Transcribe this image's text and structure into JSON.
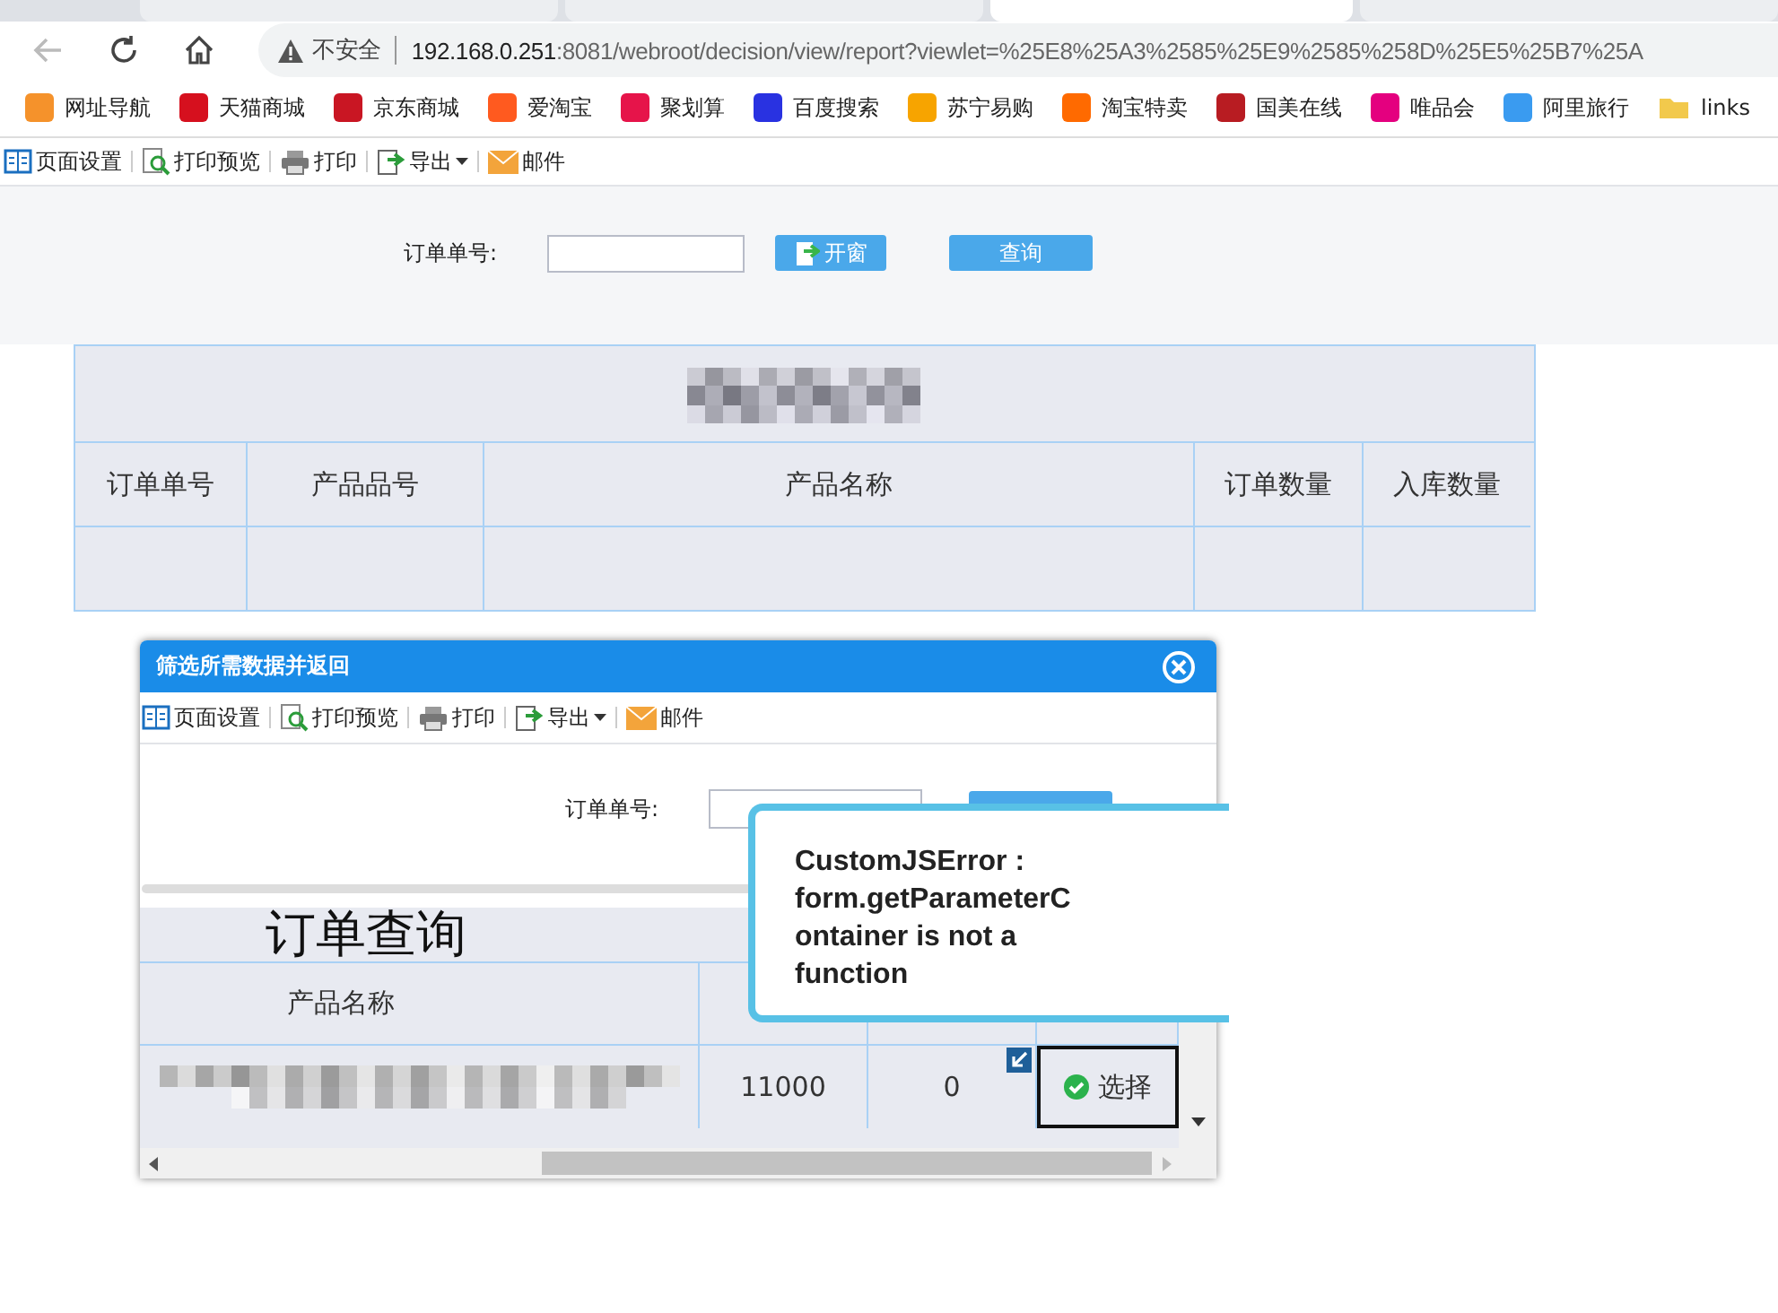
{
  "browser": {
    "tabs": [
      {
        "selected": false
      },
      {
        "selected": false
      },
      {
        "selected": true
      },
      {
        "selected": false
      }
    ],
    "security": "不安全",
    "url_host": "192.168.0.251",
    "url_rest": ":8081/webroot/decision/view/report?viewlet=%25E8%25A3%2585%25E9%2585%258D%25E5%25B7%25A",
    "bookmarks": [
      {
        "label": "网址导航",
        "color": "#f5922b",
        "kind": "site"
      },
      {
        "label": "天猫商城",
        "color": "#d6101e",
        "kind": "site"
      },
      {
        "label": "京东商城",
        "color": "#c91623",
        "kind": "site"
      },
      {
        "label": "爱淘宝",
        "color": "#ff5a1f",
        "kind": "site"
      },
      {
        "label": "聚划算",
        "color": "#e6144a",
        "kind": "site"
      },
      {
        "label": "百度搜索",
        "color": "#2932e1",
        "kind": "site"
      },
      {
        "label": "苏宁易购",
        "color": "#f7a400",
        "kind": "site"
      },
      {
        "label": "淘宝特卖",
        "color": "#ff6a00",
        "kind": "site"
      },
      {
        "label": "国美在线",
        "color": "#b81c22",
        "kind": "site"
      },
      {
        "label": "唯品会",
        "color": "#e4007f",
        "kind": "site"
      },
      {
        "label": "阿里旅行",
        "color": "#3a9bf0",
        "kind": "site"
      },
      {
        "label": "links",
        "color": "#f2c94c",
        "kind": "folder"
      }
    ]
  },
  "toolbar": [
    {
      "label": "页面设置",
      "kind": "setup"
    },
    {
      "label": "打印预览",
      "kind": "preview"
    },
    {
      "label": "打印",
      "kind": "print"
    },
    {
      "label": "导出",
      "kind": "export"
    },
    {
      "label": "邮件",
      "kind": "mail"
    }
  ],
  "params": {
    "label": "订单单号:",
    "open_button": "开窗",
    "query_button": "查询"
  },
  "report": {
    "columns": [
      "订单单号",
      "产品品号",
      "产品名称",
      "订单数量",
      "入库数量"
    ]
  },
  "dialog": {
    "title": "筛选所需数据并返回",
    "toolbar": [
      {
        "label": "页面设置",
        "kind": "setup"
      },
      {
        "label": "打印预览",
        "kind": "preview"
      },
      {
        "label": "打印",
        "kind": "print"
      },
      {
        "label": "导出",
        "kind": "export"
      },
      {
        "label": "邮件",
        "kind": "mail"
      }
    ],
    "param_label": "订单单号:",
    "report_title": "订单查询",
    "columns": [
      "产品名称"
    ],
    "row": {
      "order_qty": "11000",
      "stock_qty": "0",
      "select": "选择"
    }
  },
  "error": {
    "message": "CustomJSError : form.getParameterContainer is not a function"
  }
}
